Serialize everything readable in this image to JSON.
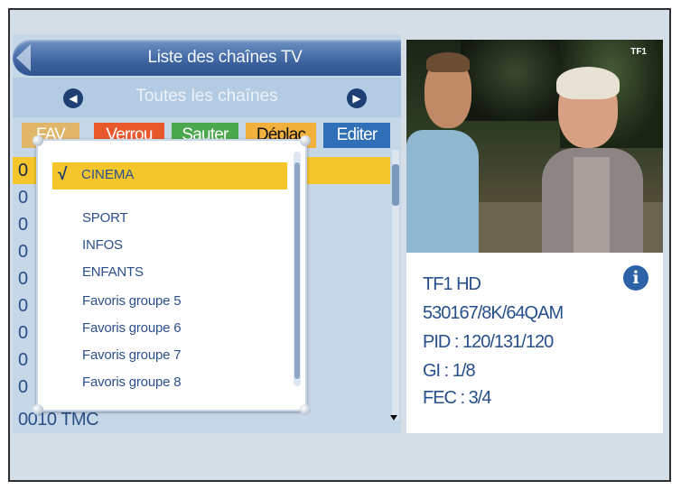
{
  "header": {
    "title": "Liste des chaînes TV",
    "group_label": "Toutes les chaînes"
  },
  "buttons": [
    {
      "label": "FAV",
      "color": "#e0b66a"
    },
    {
      "label": "Verrou",
      "color": "#e8582b"
    },
    {
      "label": "Sauter",
      "color": "#4ca84c"
    },
    {
      "label": "Déplac",
      "color": "#f2b13c"
    },
    {
      "label": "Editer",
      "color": "#2f6fb8"
    }
  ],
  "channel_list": {
    "rows": [
      "0",
      "0",
      "0",
      "0",
      "0",
      "0",
      "0",
      "0",
      "0",
      "0010 TMC"
    ]
  },
  "group_popup": {
    "selected_check": "√",
    "selected": "CINEMA",
    "items": [
      "SPORT",
      "INFOS",
      "ENFANTS",
      "Favoris groupe 5",
      "Favoris groupe 6",
      "Favoris groupe 7",
      "Favoris groupe 8"
    ]
  },
  "video": {
    "logo": "TF1"
  },
  "info": {
    "channel": "TF1 HD",
    "frequency": "530167/8K/64QAM",
    "pid": "PID : 120/131/120",
    "gi": "GI : 1/8",
    "fec": "FEC : 3/4"
  },
  "colors": {
    "highlight": "#f5c62b",
    "title_bar": "#3d64a0",
    "text_blue": "#264f8c"
  }
}
